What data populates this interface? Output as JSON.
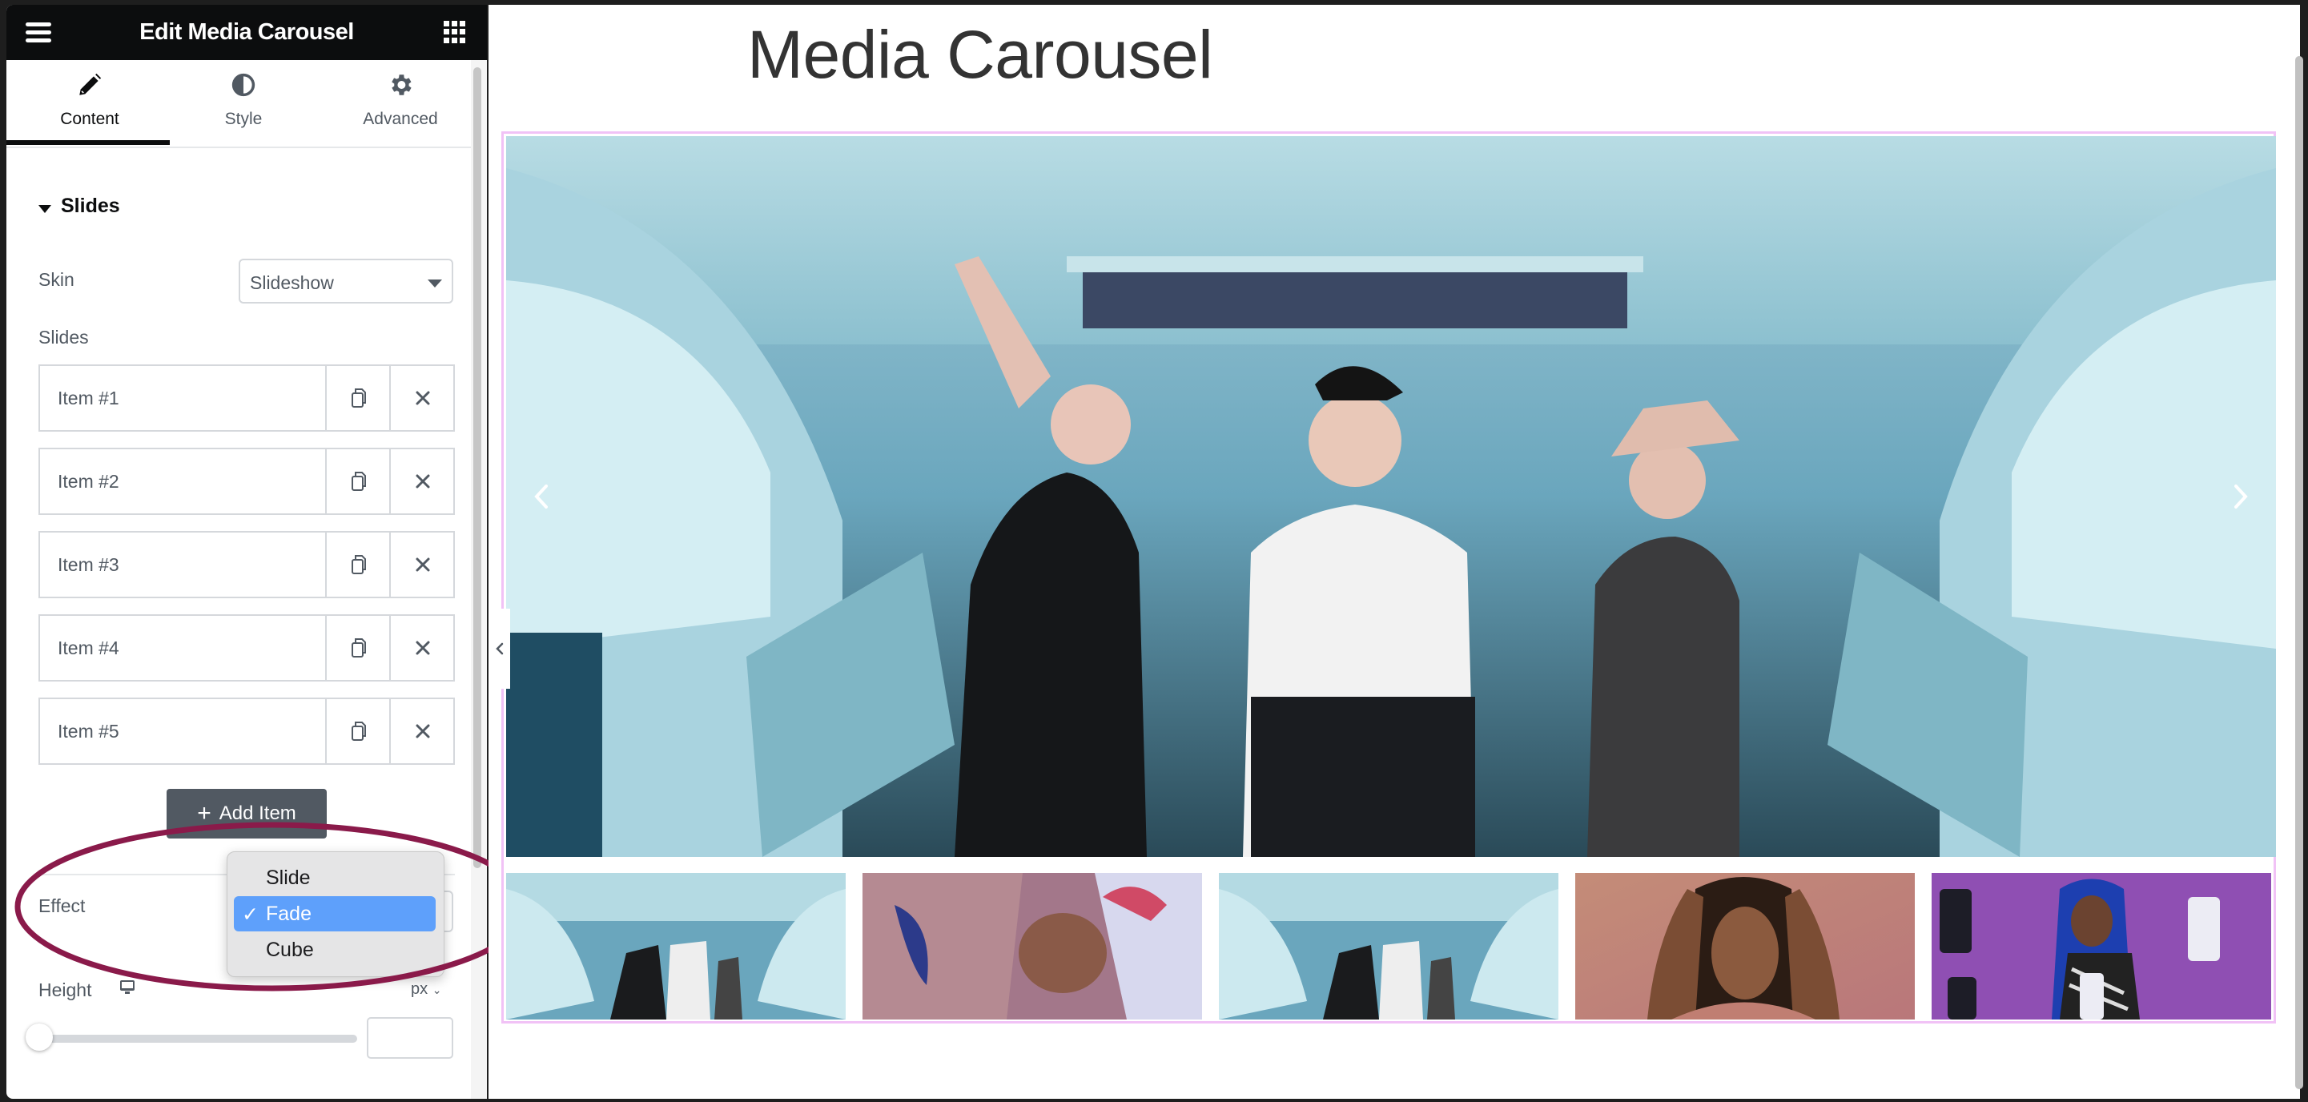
{
  "panel": {
    "title": "Edit Media Carousel",
    "menu_icon": "hamburger-menu-icon",
    "apps_icon": "grid-apps-icon",
    "tabs": [
      {
        "label": "Content",
        "icon": "pencil-icon",
        "active": true
      },
      {
        "label": "Style",
        "icon": "half-circle-icon",
        "active": false
      },
      {
        "label": "Advanced",
        "icon": "gear-icon",
        "active": false
      }
    ],
    "section_title": "Slides",
    "skin": {
      "label": "Skin",
      "value": "Slideshow"
    },
    "slides_label": "Slides",
    "items": [
      {
        "label": "Item #1"
      },
      {
        "label": "Item #2"
      },
      {
        "label": "Item #3"
      },
      {
        "label": "Item #4"
      },
      {
        "label": "Item #5"
      }
    ],
    "add_item_label": "Add Item",
    "effect": {
      "label": "Effect",
      "options": [
        "Slide",
        "Fade",
        "Cube"
      ],
      "selected": "Fade",
      "check": "✓"
    },
    "height": {
      "label": "Height",
      "unit": "px",
      "value": "",
      "slider_fraction": 0
    }
  },
  "canvas": {
    "title": "Media Carousel",
    "thumbnails": [
      "Dancers in hall",
      "Friends lying down",
      "Dancers in hall",
      "Woman with braids",
      "Woman with phones"
    ]
  },
  "colors": {
    "header_bg": "#0c0d0e",
    "annotation": "#8a1a4a",
    "selection": "#5ea0fb",
    "carousel_border": "#f1c2f6",
    "button": "#515962"
  }
}
